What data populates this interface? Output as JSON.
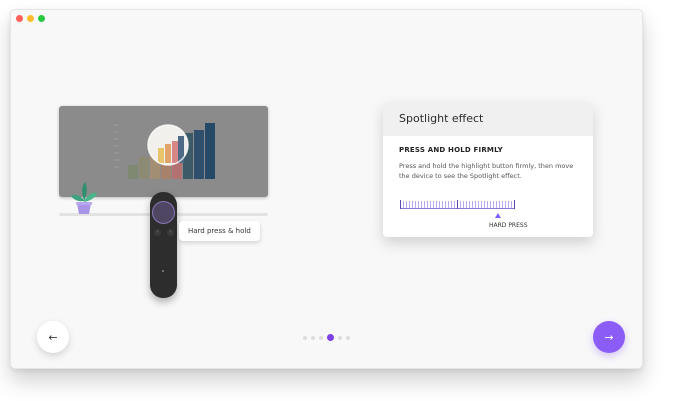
{
  "window": {
    "controls": [
      "close",
      "minimize",
      "maximize"
    ],
    "colors": {
      "close": "#fe5f57",
      "minimize": "#febc2e",
      "maximize": "#28c840"
    }
  },
  "illustration": {
    "tooltip_label": "Hard press & hold",
    "icons": [
      "presentation-screen",
      "bar-chart",
      "spotlight-circle",
      "plant",
      "presenter-remote"
    ]
  },
  "card": {
    "title": "Spotlight effect",
    "subtitle": "PRESS AND HOLD FIRMLY",
    "description": "Press and hold the highlight button firmly, then move the device to see the Spotlight effect.",
    "meter_label": "HARD PRESS",
    "accent": "#8b5cf6"
  },
  "nav": {
    "back_icon": "arrow-left-icon",
    "next_icon": "arrow-right-icon",
    "back_glyph": "←",
    "next_glyph": "→",
    "pages": 6,
    "current_page": 4
  }
}
